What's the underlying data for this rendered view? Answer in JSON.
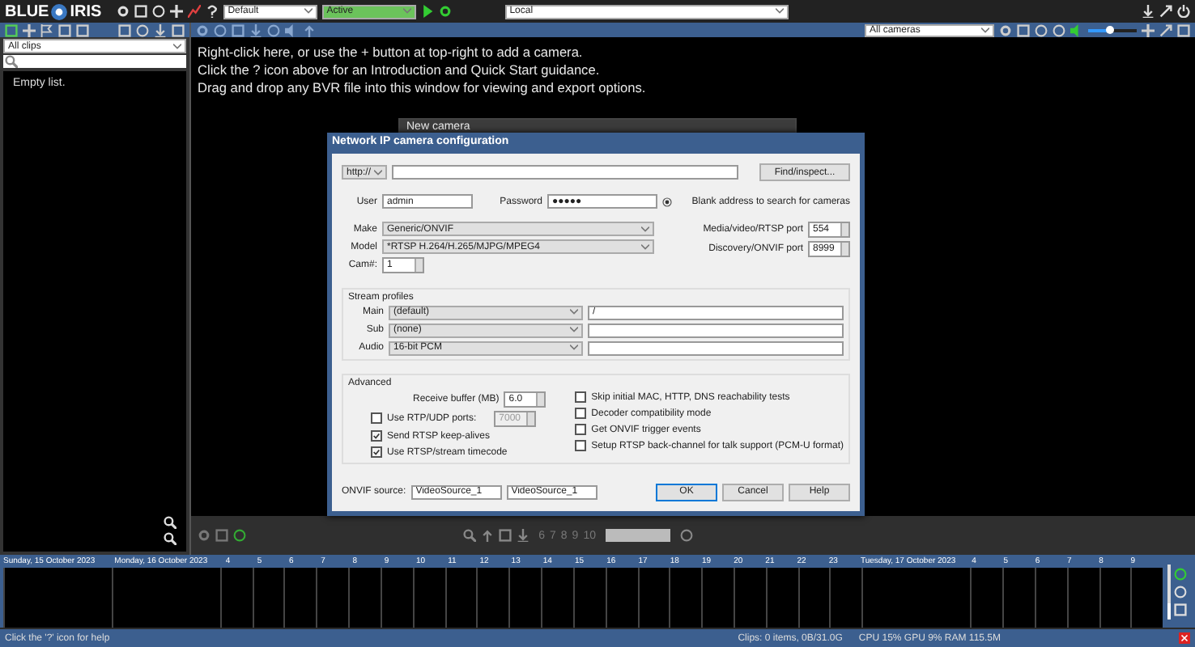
{
  "top_bar": {
    "logo_left": "BLUE",
    "logo_right": "IRIS",
    "profile": "Default",
    "schedule": "Active",
    "server": "Local"
  },
  "clips_panel": {
    "filter": "All clips",
    "empty_text": "Empty list."
  },
  "cameras_bar": {
    "group": "All cameras",
    "volume": {
      "level": 0.45
    }
  },
  "hints": [
    "Right-click here, or use the + button at top-right to add a camera.",
    "Click the ? icon above for an Introduction and Quick Start guidance.",
    "Drag and drop any BVR file into this window for viewing and export options."
  ],
  "background_window": {
    "title": "New camera"
  },
  "dialog": {
    "title": "Network IP camera configuration",
    "protocol": "http://",
    "find_button": "Find/inspect...",
    "user_label": "User",
    "user": "admin",
    "password_label": "Password",
    "password": "●●●●●",
    "blank_hint": "Blank address to search for cameras",
    "make_label": "Make",
    "make": "Generic/ONVIF",
    "model_label": "Model",
    "model": "*RTSP H.264/H.265/MJPG/MPEG4",
    "cam_label": "Cam#:",
    "cam": "1",
    "media_port_label": "Media/video/RTSP port",
    "media_port": "554",
    "discovery_port_label": "Discovery/ONVIF port",
    "discovery_port": "8999",
    "stream_title": "Stream profiles",
    "streams": [
      {
        "label": "Main",
        "profile": "(default)",
        "path": "/"
      },
      {
        "label": "Sub",
        "profile": "(none)"
      },
      {
        "label": "Audio",
        "profile": "16-bit PCM"
      }
    ],
    "advanced_title": "Advanced",
    "buffer_label": "Receive buffer (MB)",
    "buffer": "6.0",
    "left_options": [
      {
        "label": "Use RTP/UDP ports:",
        "checked": false,
        "kind": "ports",
        "value": "7000",
        "disabled": true
      },
      {
        "label": "Send RTSP keep-alives",
        "checked": true,
        "kind": "check"
      },
      {
        "label": "Use RTSP/stream timecode",
        "checked": true,
        "kind": "check"
      }
    ],
    "right_options": [
      {
        "label": "Skip initial MAC, HTTP, DNS reachability tests",
        "checked": false
      },
      {
        "label": "Decoder compatibility mode",
        "checked": false
      },
      {
        "label": "Get ONVIF trigger events",
        "checked": false
      },
      {
        "label": "Setup RTSP back-channel for talk support (PCM-U format)",
        "checked": false
      }
    ],
    "onvif_label": "ONVIF source:",
    "onvif_source": "VideoSource_1",
    "onvif_source_2": "VideoSource_1",
    "buttons": [
      "OK",
      "Cancel",
      "Help"
    ]
  },
  "ptz_bar": {
    "presets": [
      "6",
      "7",
      "8",
      "9",
      "10"
    ]
  },
  "timeline": {
    "labels": [
      {
        "text": "Sunday, 15 October 2023",
        "kind": "day"
      },
      {
        "text": "Monday, 16 October 2023",
        "kind": "day"
      },
      {
        "text": "4",
        "kind": "hour"
      },
      {
        "text": "5",
        "kind": "hour"
      },
      {
        "text": "6",
        "kind": "hour"
      },
      {
        "text": "7",
        "kind": "hour"
      },
      {
        "text": "8",
        "kind": "hour"
      },
      {
        "text": "9",
        "kind": "hour"
      },
      {
        "text": "10",
        "kind": "hour"
      },
      {
        "text": "11",
        "kind": "hour"
      },
      {
        "text": "12",
        "kind": "hour"
      },
      {
        "text": "13",
        "kind": "hour"
      },
      {
        "text": "14",
        "kind": "hour"
      },
      {
        "text": "15",
        "kind": "hour"
      },
      {
        "text": "16",
        "kind": "hour"
      },
      {
        "text": "17",
        "kind": "hour"
      },
      {
        "text": "18",
        "kind": "hour"
      },
      {
        "text": "19",
        "kind": "hour"
      },
      {
        "text": "20",
        "kind": "hour"
      },
      {
        "text": "21",
        "kind": "hour"
      },
      {
        "text": "22",
        "kind": "hour"
      },
      {
        "text": "23",
        "kind": "hour"
      },
      {
        "text": "Tuesday, 17 October 2023",
        "kind": "day"
      },
      {
        "text": "4",
        "kind": "hour"
      },
      {
        "text": "5",
        "kind": "hour"
      },
      {
        "text": "6",
        "kind": "hour"
      },
      {
        "text": "7",
        "kind": "hour"
      },
      {
        "text": "8",
        "kind": "hour"
      },
      {
        "text": "9",
        "kind": "hour"
      }
    ],
    "zoom": {
      "level": 0.3
    }
  },
  "status_bar": {
    "help": "Click the '?' icon for help",
    "clips": "Clips: 0 items, 0B/31.0G",
    "usage": "CPU 15% GPU 9% RAM 115.5M"
  }
}
